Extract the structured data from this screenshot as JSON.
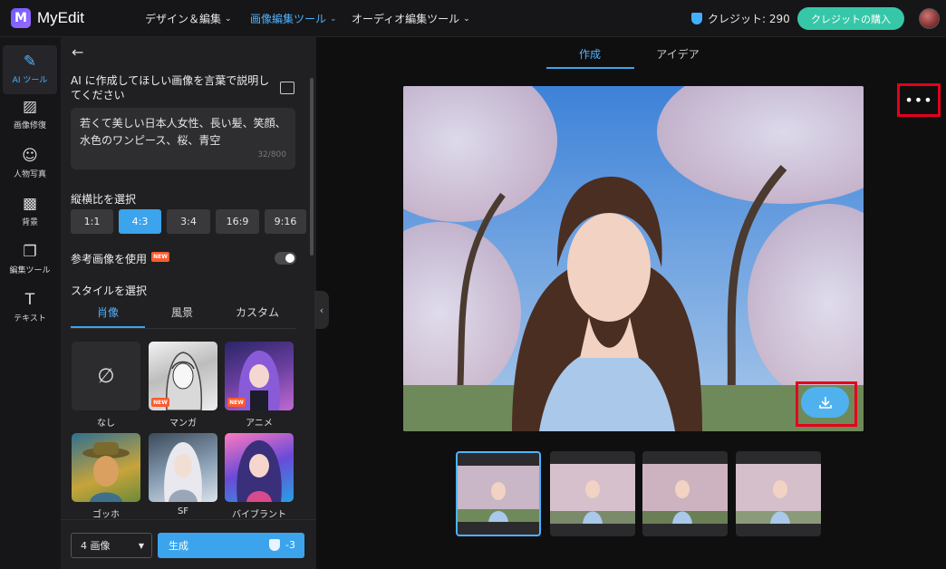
{
  "app": {
    "logo_letter": "M",
    "name": "MyEdit"
  },
  "topnav": [
    {
      "label": "デザイン＆編集",
      "active": false
    },
    {
      "label": "画像編集ツール",
      "active": true
    },
    {
      "label": "オーディオ編集ツール",
      "active": false
    }
  ],
  "credits": {
    "label": "クレジット: 290",
    "buy_label": "クレジットの購入"
  },
  "rail": [
    {
      "label": "AI ツール",
      "icon": "magic-wand-icon",
      "glyph": "✎",
      "active": true
    },
    {
      "label": "画像修復",
      "icon": "image-repair-icon",
      "glyph": "▨",
      "active": false
    },
    {
      "label": "人物写真",
      "icon": "portrait-icon",
      "glyph": "☺",
      "active": false
    },
    {
      "label": "背景",
      "icon": "background-icon",
      "glyph": "▩",
      "active": false
    },
    {
      "label": "編集ツール",
      "icon": "edit-tools-icon",
      "glyph": "❐",
      "active": false
    },
    {
      "label": "テキスト",
      "icon": "text-icon",
      "glyph": "T",
      "active": false
    }
  ],
  "panel": {
    "prompt_title": "AI に作成してほしい画像を言葉で説明してください",
    "prompt_text": "若くて美しい日本人女性、長い髪、笑顔、水色のワンピース、桜、青空",
    "prompt_count": "32/800",
    "ratio_label": "縦横比を選択",
    "ratios": [
      "1:1",
      "4:3",
      "3:4",
      "16:9",
      "9:16"
    ],
    "ratio_selected": "4:3",
    "reference_label": "参考画像を使用",
    "new_badge": "NEW",
    "style_label": "スタイルを選択",
    "style_tabs": [
      "肖像",
      "風景",
      "カスタム"
    ],
    "styles": [
      "なし",
      "マンガ",
      "アニメ",
      "ゴッホ",
      "SF",
      "バイブラント"
    ],
    "none_symbol": "∅",
    "image_count": "4 画像",
    "generate_label": "生成",
    "generate_cost": "-3"
  },
  "main": {
    "tabs": [
      "作成",
      "アイデア"
    ],
    "more_label": "•••"
  },
  "colors": {
    "accent": "#3ca4ec",
    "highlight": "#e4001b",
    "buy": "#36c7a8"
  }
}
